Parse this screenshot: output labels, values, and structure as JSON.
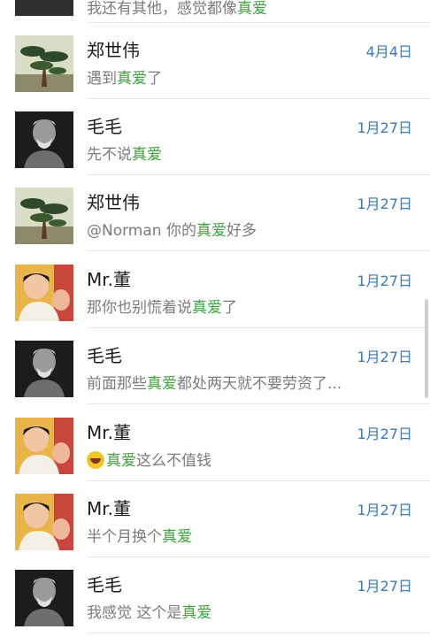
{
  "top_snippet": {
    "before": "我还有其他，感觉都像",
    "highlight": "真爱",
    "after": ""
  },
  "conversations": [
    {
      "name": "郑世伟",
      "date": "4月4日",
      "avatar": "pine-tree",
      "snippet": {
        "before": "遇到",
        "highlight": "真爱",
        "after": "了"
      }
    },
    {
      "name": "毛毛",
      "date": "1月27日",
      "avatar": "old-man",
      "snippet": {
        "before": "先不说",
        "highlight": "真爱",
        "after": ""
      }
    },
    {
      "name": "郑世伟",
      "date": "1月27日",
      "avatar": "pine-tree",
      "snippet": {
        "before": "@Norman 你的",
        "highlight": "真爱",
        "after": "好多"
      }
    },
    {
      "name": "Mr.董",
      "date": "1月27日",
      "avatar": "child",
      "snippet": {
        "before": "那你也别慌着说",
        "highlight": "真爱",
        "after": "了"
      }
    },
    {
      "name": "毛毛",
      "date": "1月27日",
      "avatar": "old-man",
      "snippet": {
        "before": "前面那些",
        "highlight": "真爱",
        "after": "都处两天就不要劳资了..."
      }
    },
    {
      "name": "Mr.董",
      "date": "1月27日",
      "avatar": "child",
      "emoji": "laughing-emoji",
      "snippet": {
        "before": "",
        "highlight": "真爱",
        "after": "这么不值钱"
      }
    },
    {
      "name": "Mr.董",
      "date": "1月27日",
      "avatar": "child",
      "snippet": {
        "before": "半个月换个",
        "highlight": "真爱",
        "after": ""
      }
    },
    {
      "name": "毛毛",
      "date": "1月27日",
      "avatar": "old-man",
      "snippet": {
        "before": "我感觉  这个是",
        "highlight": "真爱",
        "after": ""
      }
    }
  ],
  "colors": {
    "highlight": "#3ea33e",
    "date": "#3a78b6",
    "name": "#1a1a1a",
    "snippet": "#7b7b7b"
  }
}
